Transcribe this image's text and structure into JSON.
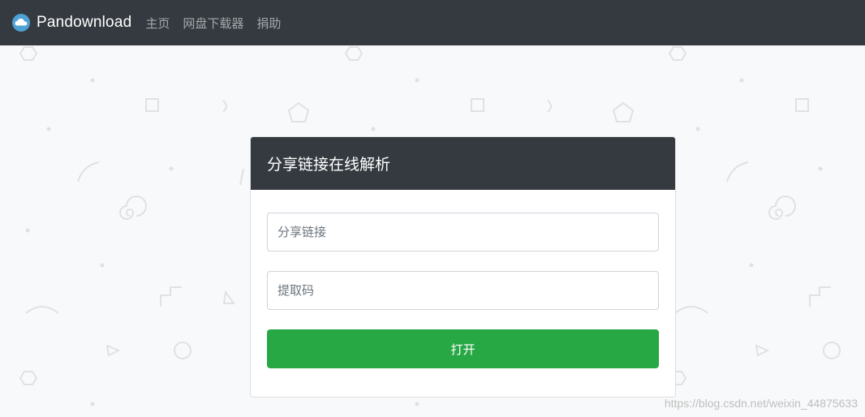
{
  "navbar": {
    "brand": "Pandownload",
    "brand_icon": "cloud-icon",
    "links": [
      {
        "label": "主页"
      },
      {
        "label": "网盘下载器"
      },
      {
        "label": "捐助"
      }
    ]
  },
  "card": {
    "title": "分享链接在线解析",
    "share_link_placeholder": "分享链接",
    "code_placeholder": "提取码",
    "submit_label": "打开"
  },
  "watermark": "https://blog.csdn.net/weixin_44875633",
  "colors": {
    "navbar": "#343a40",
    "button": "#28a745",
    "background": "#f8f9fa"
  }
}
